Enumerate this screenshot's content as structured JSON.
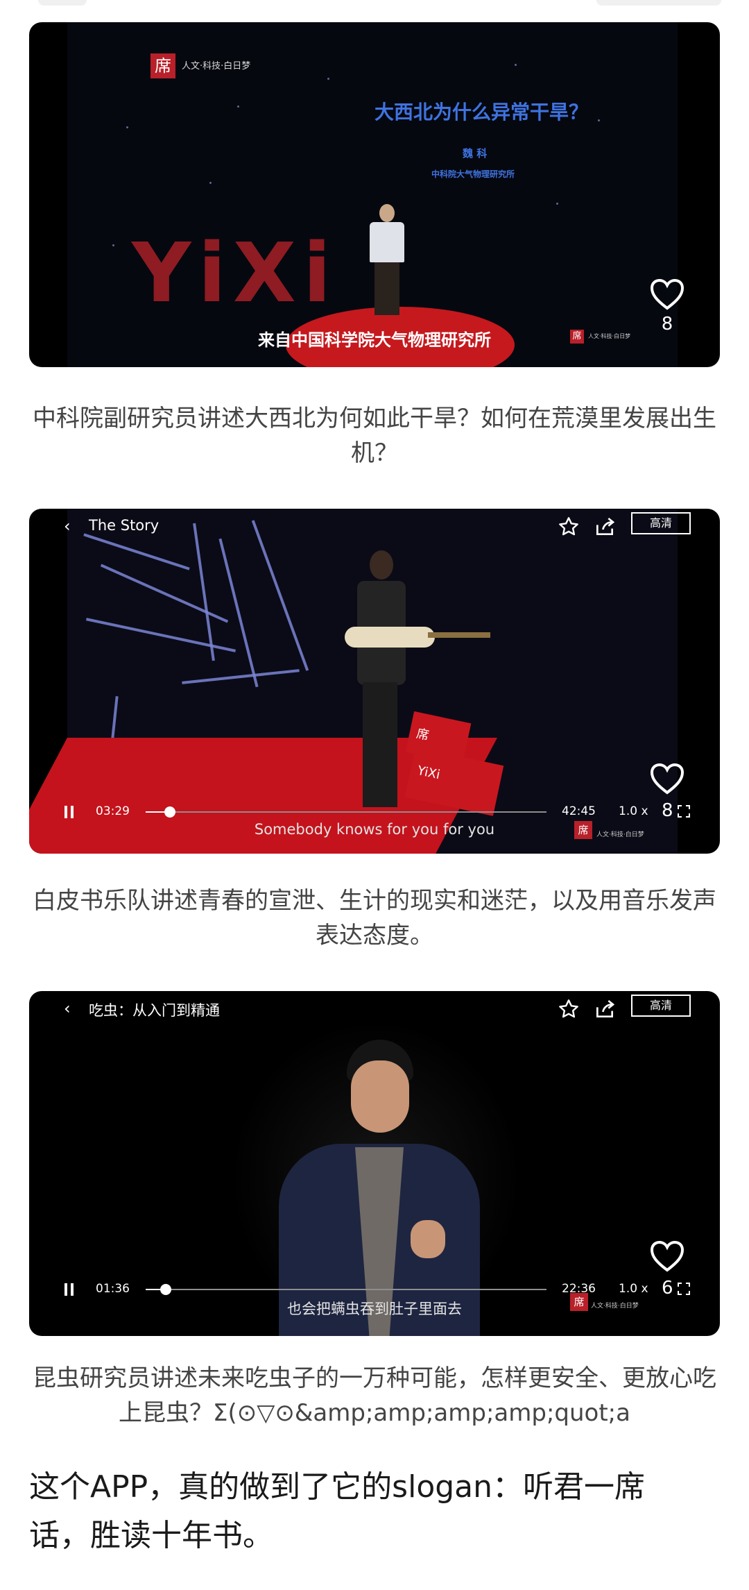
{
  "cards": [
    {
      "caption": "中科院副研究员讲述大西北为何如此干旱？如何在荒漠里发展出生机？",
      "video": {
        "logo_char": "席",
        "logo_text": "人文·科技·白日梦",
        "talk_title": "大西北为什么异常干旱？",
        "speaker": "魏 科",
        "institution": "中科院大气物理研究所",
        "stage_letters": "YiXi",
        "subtitle": "来自中国科学院大气物理研究所",
        "watermark_char": "席",
        "watermark_text": "人文·科技·白日梦",
        "like_count": "8"
      }
    },
    {
      "caption": "白皮书乐队讲述青春的宣泄、生计的现实和迷茫，以及用音乐发声表达态度。",
      "video": {
        "title": "The Story",
        "hd_label": "高清",
        "current_time": "03:29",
        "total_time": "42:45",
        "speed": "1.0 x",
        "count": "8",
        "progress": 0.06,
        "subtitle": "Somebody knows for you for you",
        "box_char": "席",
        "box_text": "YiXi",
        "watermark_char": "席",
        "watermark_text": "人文·科技·白日梦"
      }
    },
    {
      "caption": "昆虫研究员讲述未来吃虫子的一万种可能，怎样更安全、更放心吃上昆虫？Σ(⊙▽⊙&amp;amp;amp;amp;quot;a",
      "video": {
        "title": "吃虫：从入门到精通",
        "hd_label": "高清",
        "current_time": "01:36",
        "total_time": "22:36",
        "speed": "1.0 x",
        "count": "6",
        "progress": 0.05,
        "subtitle": "也会把螨虫吞到肚子里面去",
        "watermark_char": "席",
        "watermark_text": "人文·科技·白日梦"
      }
    }
  ],
  "closing_text": "这个APP，真的做到了它的slogan：听君一席话，胜读十年书。",
  "colors": {
    "brand_red": "#b8202a",
    "stage_blue": "#3f73e0",
    "caption_gray": "#444444"
  }
}
